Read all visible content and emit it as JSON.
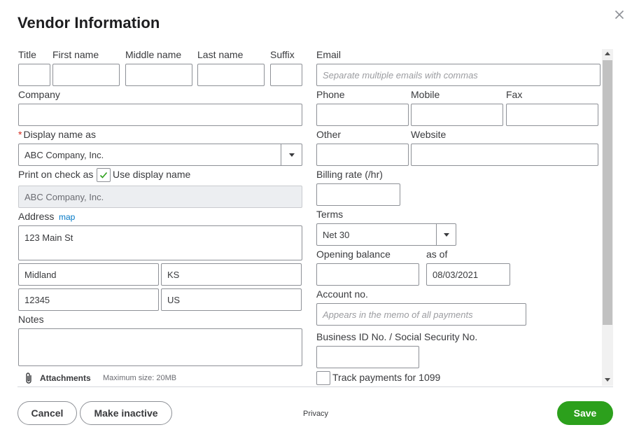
{
  "title": "Vendor Information",
  "name_fields": {
    "title_label": "Title",
    "first_label": "First name",
    "middle_label": "Middle name",
    "last_label": "Last name",
    "suffix_label": "Suffix"
  },
  "company_label": "Company",
  "display_name": {
    "required_mark": "*",
    "label": "Display name as",
    "value": "ABC Company, Inc."
  },
  "print_on_check": {
    "label": "Print on check as",
    "checkbox_label": "Use display name",
    "checked": true,
    "value": "ABC Company, Inc."
  },
  "address": {
    "label": "Address",
    "map_link": "map",
    "street": "123 Main St",
    "city": "Midland",
    "state": "KS",
    "zip": "12345",
    "country": "US"
  },
  "notes_label": "Notes",
  "attachments": {
    "label": "Attachments",
    "max_size": "Maximum size: 20MB"
  },
  "email": {
    "label": "Email",
    "placeholder": "Separate multiple emails with commas"
  },
  "phone_label": "Phone",
  "mobile_label": "Mobile",
  "fax_label": "Fax",
  "other_label": "Other",
  "website_label": "Website",
  "billing_rate_label": "Billing rate (/hr)",
  "terms": {
    "label": "Terms",
    "value": "Net 30"
  },
  "opening_balance": {
    "label": "Opening balance",
    "as_of_label": "as of",
    "as_of_value": "08/03/2021"
  },
  "account_no": {
    "label": "Account no.",
    "placeholder": "Appears in the memo of all payments"
  },
  "business_id_label": "Business ID No. / Social Security No.",
  "track_1099": {
    "label": "Track payments for 1099",
    "checked": false
  },
  "footer": {
    "cancel": "Cancel",
    "make_inactive": "Make inactive",
    "privacy": "Privacy",
    "save": "Save"
  },
  "colors": {
    "primary": "#2ca01c",
    "link": "#0077c5",
    "required": "#d52b1e",
    "border": "#8d9096"
  },
  "icons": {
    "close": "close-icon",
    "dropdown": "chevron-down-icon",
    "check": "check-icon",
    "attachment": "paperclip-icon"
  }
}
